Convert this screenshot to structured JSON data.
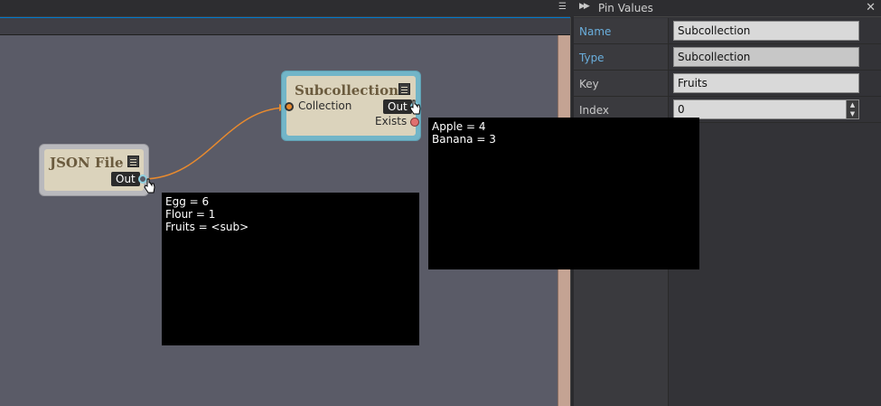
{
  "panel": {
    "title": "Pin Values",
    "rows": [
      {
        "label": "Name",
        "value": "Subcollection"
      },
      {
        "label": "Type",
        "value": "Subcollection"
      },
      {
        "label": "Key",
        "value": "Fruits"
      },
      {
        "label": "Index",
        "value": "0"
      }
    ]
  },
  "nodes": {
    "json_file": {
      "title": "JSON File",
      "out_label": "Out"
    },
    "subcollection": {
      "title": "Subcollection",
      "collection_label": "Collection",
      "out_label": "Out",
      "exists_label": "Exists"
    }
  },
  "tooltips": {
    "json_out": [
      "Egg = 6",
      "Flour = 1",
      "Fruits = <sub>"
    ],
    "sub_out": [
      "Apple = 4",
      "Banana = 3"
    ]
  },
  "colors": {
    "canvas": "#5a5b67",
    "wire": "#e88a2e",
    "node_body": "#dbd3bc",
    "selected_border": "#72b5c8",
    "accent_label": "#6aaedc"
  }
}
